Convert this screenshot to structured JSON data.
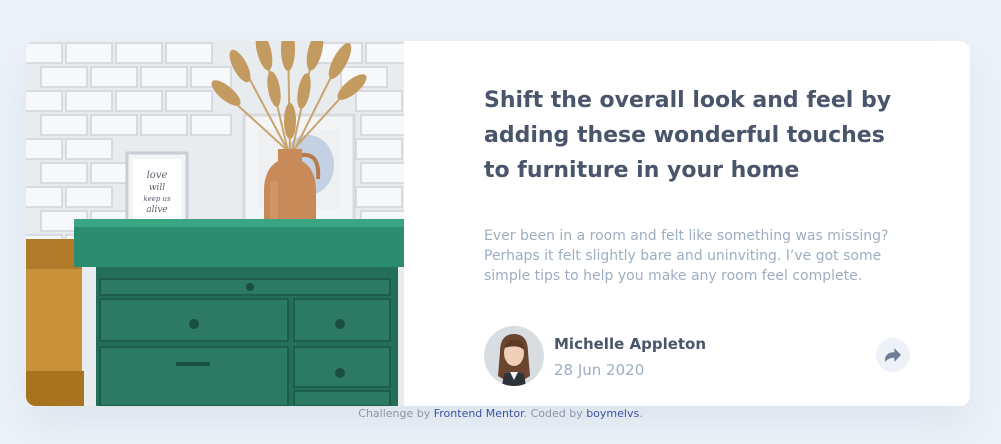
{
  "article": {
    "headline": "Shift the overall look and feel by adding these wonderful touches to furniture in your home",
    "excerpt": "Ever been in a room and felt like something was missing? Perhaps it felt slightly bare and uninviting. I’ve got some simple tips to help you make any room feel complete.",
    "image": {
      "icon": "drawers-photo",
      "frame_text": [
        "love",
        "will",
        "keep us",
        "alive"
      ]
    }
  },
  "author": {
    "name": "Michelle Appleton",
    "date": "28 Jun 2020",
    "avatar_icon": "avatar-photo"
  },
  "share": {
    "icon": "share-icon"
  },
  "attribution": {
    "prefix": "Challenge by",
    "link1": "Frontend Mentor",
    "middle": ". Coded by",
    "link2": "boymelvs",
    "suffix": "."
  },
  "colors": {
    "background": "#ECF2F8",
    "card": "#FFFFFF",
    "heading": "#48556A",
    "muted": "#9DAEC2",
    "link": "#3E52A3",
    "dresser": "#2C7A64"
  }
}
